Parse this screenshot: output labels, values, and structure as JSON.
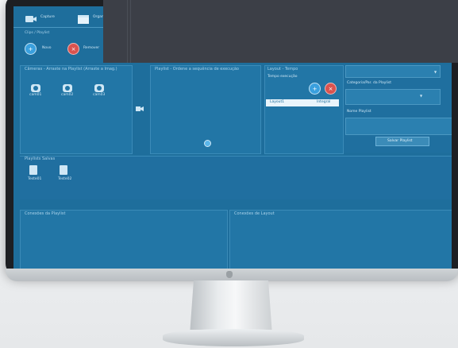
{
  "toolbar": {
    "tab1_label": "Capture",
    "tab2_label": "Organiz",
    "clips_label": "Clips / Playlist"
  },
  "clip_actions": {
    "new_label": "Novo",
    "remove_label": "Remover"
  },
  "cameras_panel": {
    "title": "Câmeras - Arraste na Playlist (Arraste a Imag.)",
    "cameras": [
      "cam01",
      "cam02",
      "cam03"
    ]
  },
  "playlist_panel": {
    "title": "Playlist - Ordene a sequência de execução"
  },
  "layout_panel": {
    "title": "Layout - Tempo",
    "time_label": "Tempo execução",
    "layout_item": "Layout1",
    "layout_item_value": "Integral"
  },
  "right_panel": {
    "category_label": "Categoria/Par. da Playlist",
    "name_label": "Nome Playlist",
    "save_label": "Salvar Playlist"
  },
  "saved_playlists": {
    "title": "Playlists Salvas",
    "items": [
      "Teste01",
      "Teste02"
    ]
  },
  "bottom": {
    "left_title": "Conexões da Playlist",
    "right_title": "Conexões de Layout"
  },
  "colors": {
    "screen": "#1e6e9c",
    "panel": "#2276a6",
    "remove_red": "#d9534f",
    "accent_blue": "#3aa0de"
  }
}
